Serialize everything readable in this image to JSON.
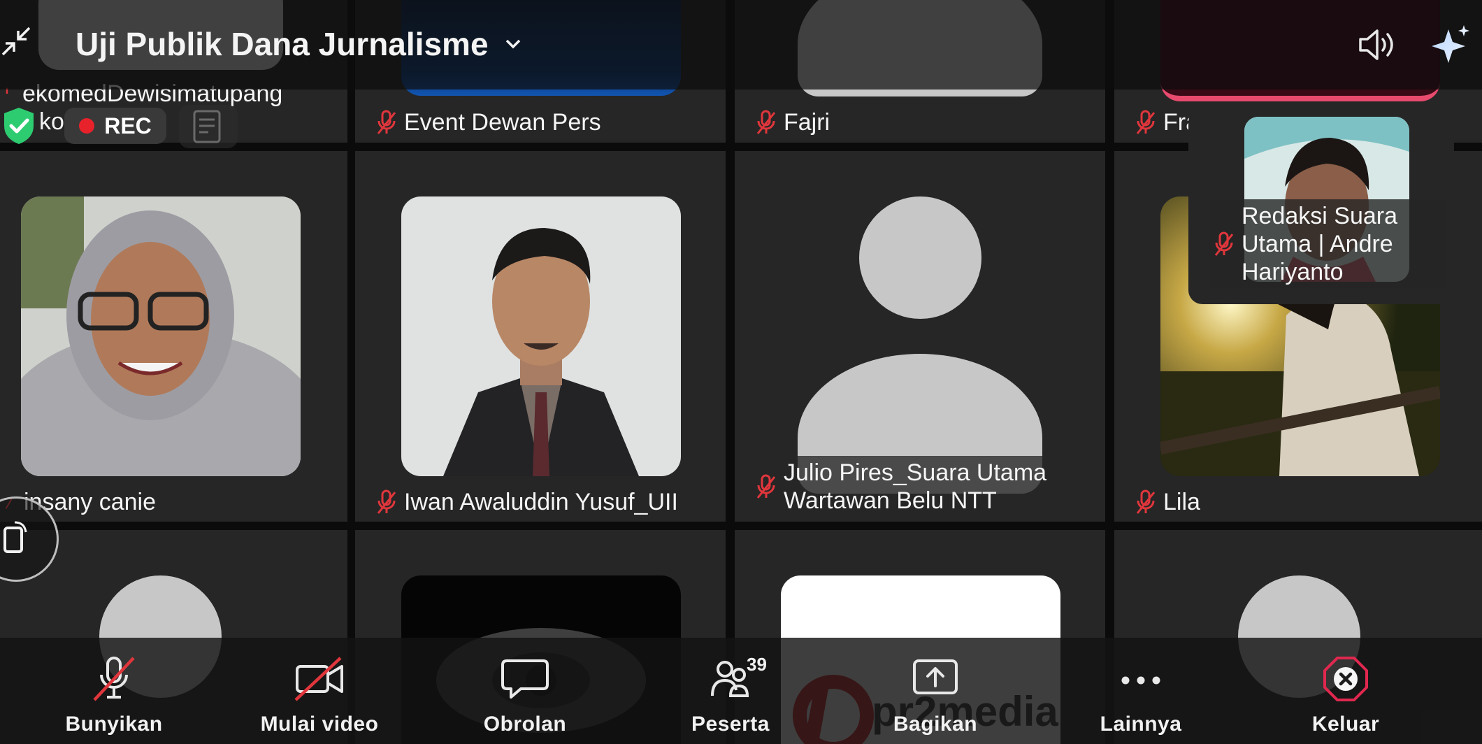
{
  "meeting": {
    "title": "Uji Publik Dana Jurnalisme",
    "rec_label": "REC"
  },
  "participants_row1": [
    {
      "name": "ekomedDewisimatupang"
    },
    {
      "name": "Event Dewan Pers"
    },
    {
      "name": "Fajri"
    },
    {
      "name": "Fra"
    }
  ],
  "row1_partial_text": "ko",
  "participants_row2": [
    {
      "name": "insany canie"
    },
    {
      "name": "Iwan Awaluddin Yusuf_UII"
    },
    {
      "name_line1": "Julio Pires_Suara Utama",
      "name_line2": "Wartawan Belu NTT"
    },
    {
      "name": "Lila"
    }
  ],
  "self_view": {
    "name_line1": "Redaksi Suara",
    "name_line2": "Utama | Andre",
    "name_line3": "Hariyanto"
  },
  "logo_text": "pr2media",
  "toolbar": {
    "mute_label": "Bunyikan",
    "video_label": "Mulai video",
    "chat_label": "Obrolan",
    "participants_label": "Peserta",
    "participants_count": "39",
    "share_label": "Bagikan",
    "more_label": "Lainnya",
    "leave_label": "Keluar"
  },
  "colors": {
    "tile_bg": "#262626",
    "muted_red": "#e0363c",
    "shield_green": "#2ecc71",
    "rec_red": "#e8222b",
    "leave_red": "#e0284f",
    "placeholder_gray": "#c8c7c8"
  },
  "icons": [
    "exit-fullscreen-icon",
    "chevron-down-icon",
    "speaker-icon",
    "sparkle-icon",
    "shield-check-icon",
    "transcript-icon",
    "mic-muted-icon",
    "video-off-icon",
    "chat-icon",
    "participants-icon",
    "share-icon",
    "more-icon",
    "leave-icon",
    "rotate-screen-icon"
  ]
}
